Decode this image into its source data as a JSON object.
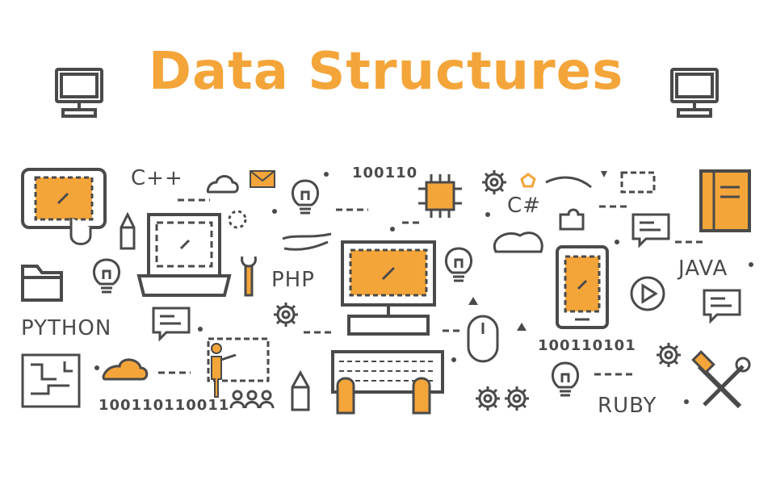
{
  "title": "Data Structures",
  "labels": {
    "cpp": "C++",
    "csharp": "C#",
    "php": "PHP",
    "python": "PYTHON",
    "java": "JAVA",
    "ruby": "RUBY",
    "binary_top": "100110",
    "binary_right": "100110101",
    "binary_bottom": "100110110011"
  },
  "colors": {
    "accent": "#f4a53a",
    "line": "#4a4a4a"
  },
  "icons": [
    "monitor-icon",
    "tablet-touch-icon",
    "laptop-icon",
    "desktop-computer-icon",
    "keyboard-hands-icon",
    "smartphone-icon",
    "book-icon",
    "lightbulb-icon",
    "gear-icon",
    "wrench-icon",
    "chat-bubble-icon",
    "cloud-icon",
    "chip-icon",
    "brain-icon",
    "mouse-icon",
    "puzzle-icon",
    "folder-icon",
    "circuit-icon",
    "presenter-icon",
    "tools-icon",
    "pencil-icon",
    "envelope-icon",
    "play-button-icon"
  ]
}
